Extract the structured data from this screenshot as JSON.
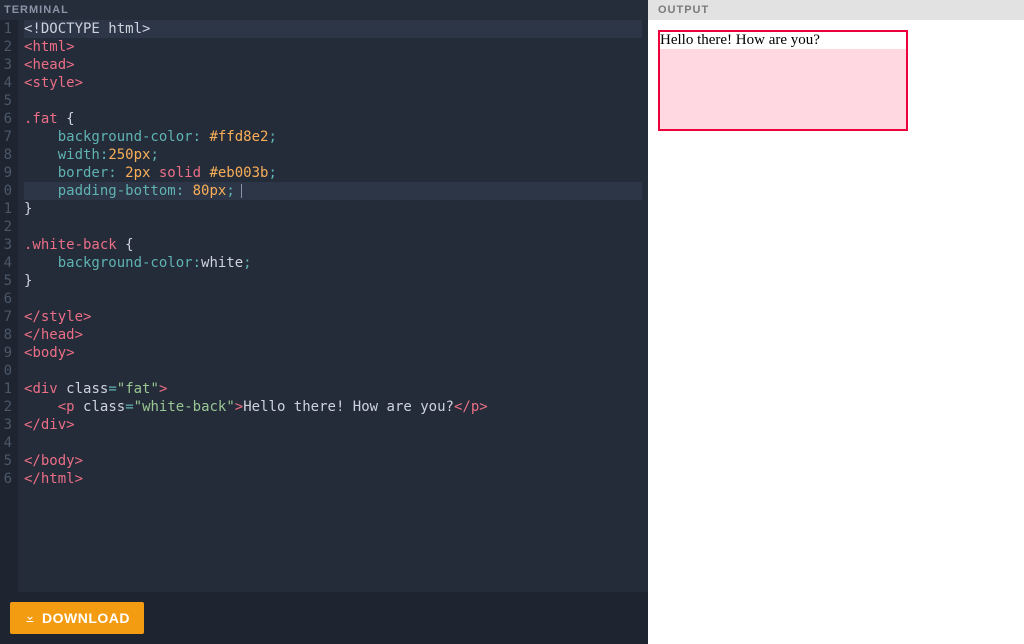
{
  "editor": {
    "header": "TERMINAL",
    "download_label": "DOWNLOAD",
    "cursor_line": 10,
    "line_numbers": [
      "1",
      "2",
      "3",
      "4",
      "5",
      "6",
      "7",
      "8",
      "9",
      "0",
      "1",
      "2",
      "3",
      "4",
      "5",
      "6",
      "7",
      "8",
      "9",
      "0",
      "1",
      "2",
      "3",
      "4",
      "5",
      "6"
    ],
    "code": {
      "l1": {
        "doctype": "<!DOCTYPE html>"
      },
      "l2": {
        "open": "<",
        "tag": "html",
        "close": ">"
      },
      "l3": {
        "open": "<",
        "tag": "head",
        "close": ">"
      },
      "l4": {
        "open": "<",
        "tag": "style",
        "close": ">"
      },
      "l6": {
        "sel": ".fat",
        "brace": " {"
      },
      "l7": {
        "indent": "    ",
        "prop": "background-color",
        "colon": ": ",
        "val": "#ffd8e2",
        "semi": ";"
      },
      "l8": {
        "indent": "    ",
        "prop": "width",
        "colon": ":",
        "val": "250px",
        "semi": ";"
      },
      "l9": {
        "indent": "    ",
        "prop": "border",
        "colon": ": ",
        "num": "2px ",
        "kw": "solid ",
        "col": "#eb003b",
        "semi": ";"
      },
      "l10": {
        "indent": "    ",
        "prop": "padding-bottom",
        "colon": ": ",
        "val": "80px",
        "semi": ";"
      },
      "l11": {
        "brace": "}"
      },
      "l13": {
        "sel": ".white-back",
        "brace": " {"
      },
      "l14": {
        "indent": "    ",
        "prop": "background-color",
        "colon": ":",
        "val": "white",
        "semi": ";"
      },
      "l15": {
        "brace": "}"
      },
      "l17": {
        "open": "</",
        "tag": "style",
        "close": ">"
      },
      "l18": {
        "open": "</",
        "tag": "head",
        "close": ">"
      },
      "l19": {
        "open": "<",
        "tag": "body",
        "close": ">"
      },
      "l21": {
        "open": "<",
        "tag": "div",
        "sp": " ",
        "attr": "class",
        "eq": "=",
        "q1": "\"",
        "str": "fat",
        "q2": "\"",
        "close": ">"
      },
      "l22": {
        "indent": "    ",
        "open": "<",
        "tag": "p",
        "sp": " ",
        "attr": "class",
        "eq": "=",
        "q1": "\"",
        "str": "white-back",
        "q2": "\"",
        "close": ">",
        "text": "Hello there! How are you?",
        "open2": "</",
        "tag2": "p",
        "close2": ">"
      },
      "l23": {
        "open": "</",
        "tag": "div",
        "close": ">"
      },
      "l25": {
        "open": "</",
        "tag": "body",
        "close": ">"
      },
      "l26": {
        "open": "</",
        "tag": "html",
        "close": ">"
      }
    }
  },
  "output": {
    "header": "OUTPUT",
    "rendered_text": "Hello there! How are you?"
  },
  "colors": {
    "editor_bg": "#252c39",
    "accent": "#f39c12",
    "render_bg": "#ffd8e2",
    "render_border": "#eb003b"
  }
}
